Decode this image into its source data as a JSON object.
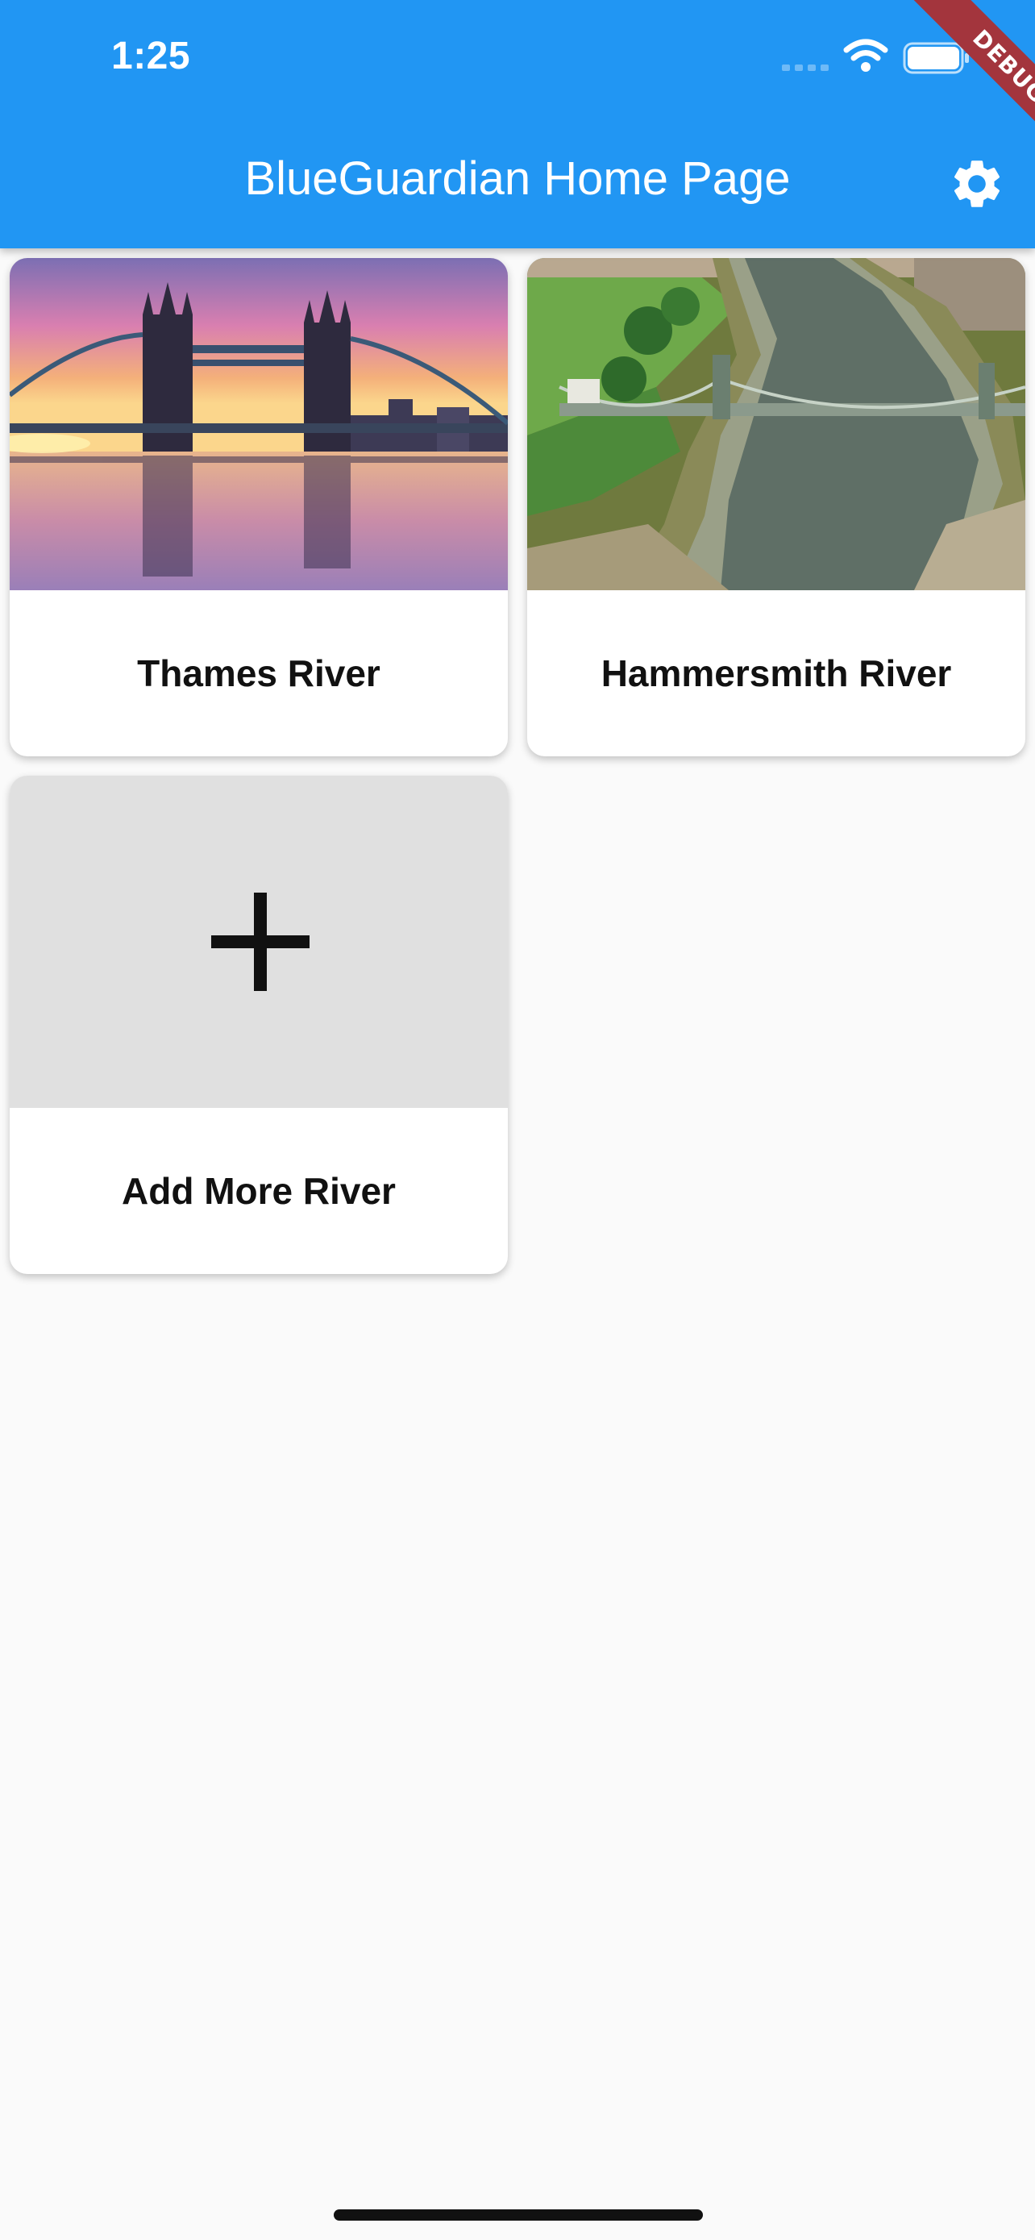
{
  "status_bar": {
    "time": "1:25"
  },
  "app_bar": {
    "title": "BlueGuardian Home Page",
    "settings_icon": "gear-icon",
    "background": "#2196F3"
  },
  "debug_banner": {
    "label": "DEBUG",
    "color": "#a3353d"
  },
  "rivers": [
    {
      "name": "Thames River",
      "image": "tower-bridge-sunset-photo"
    },
    {
      "name": "Hammersmith River",
      "image": "hammersmith-bridge-aerial-photo"
    },
    {
      "name": "Add More River",
      "image": "plus-icon"
    }
  ]
}
